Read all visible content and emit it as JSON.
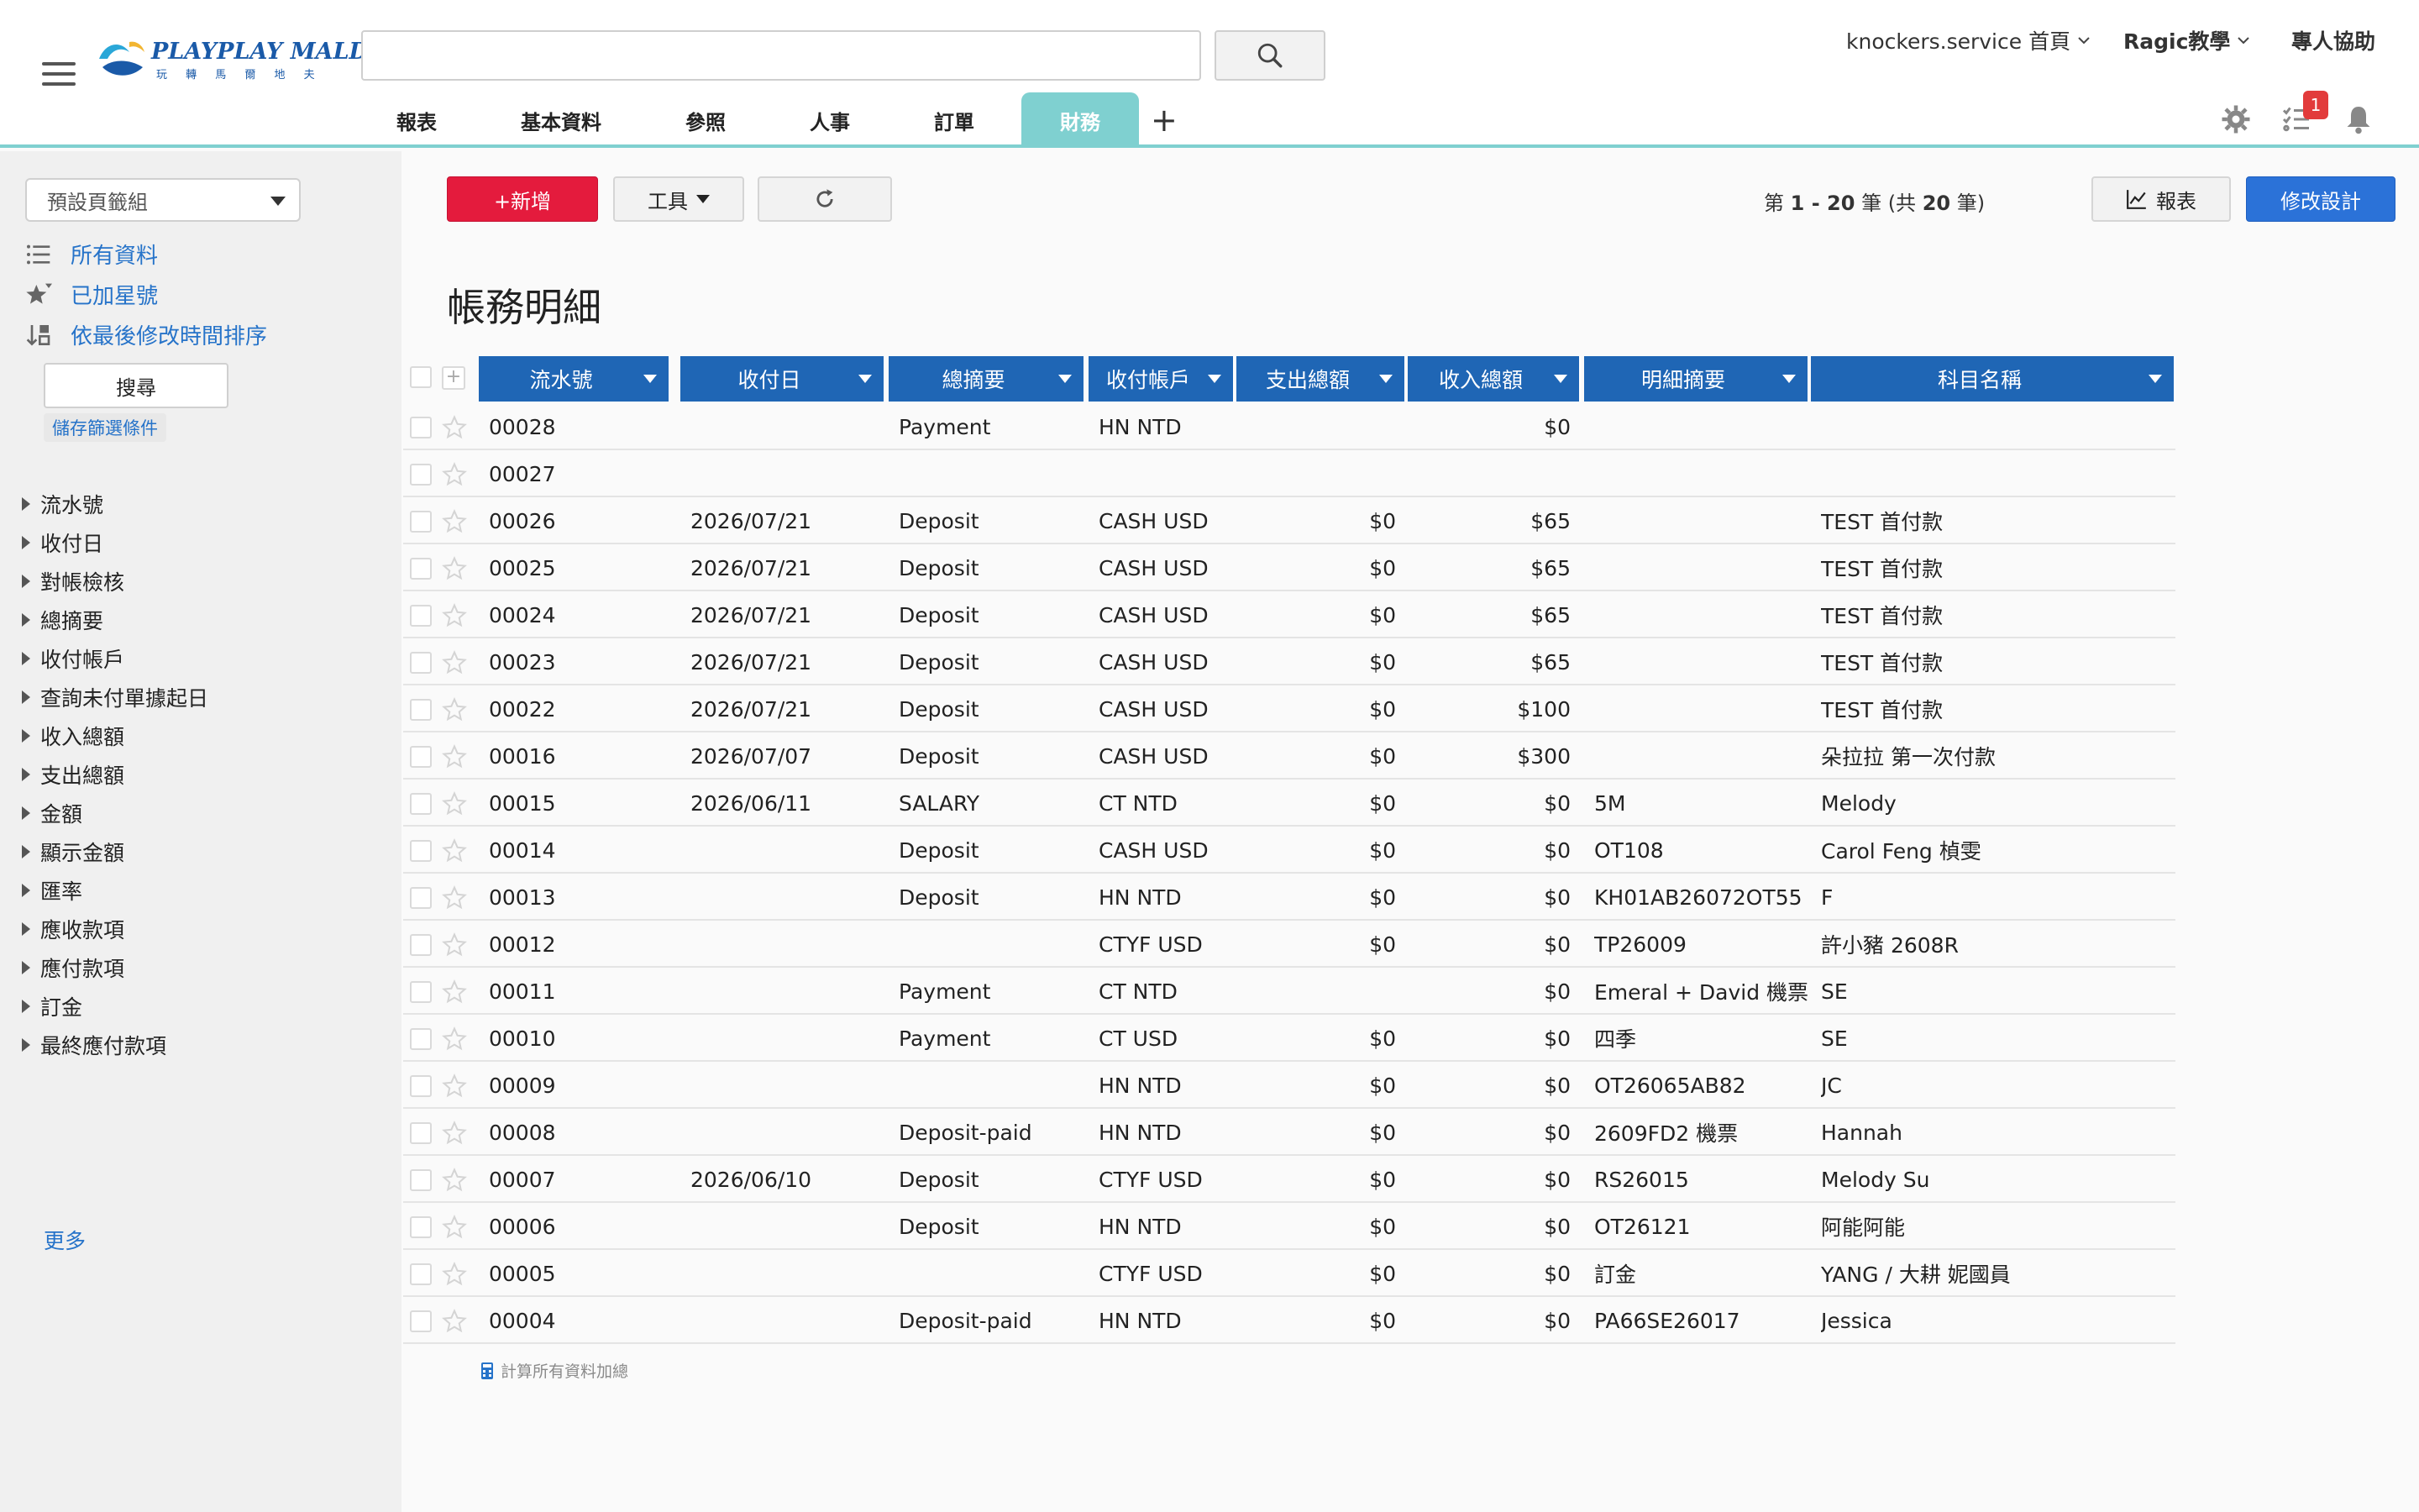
{
  "header": {
    "logo_text": "PLAYPLAY MALDIVES",
    "logo_sub": "玩 轉 馬 爾 地 夫",
    "search_placeholder": "",
    "user_menu": "knockers.service 首頁",
    "tutorial_menu": "Ragic教學",
    "help_link": "專人協助",
    "notification_count": "1"
  },
  "tabs": [
    {
      "label": "報表"
    },
    {
      "label": "基本資料"
    },
    {
      "label": "參照"
    },
    {
      "label": "人事"
    },
    {
      "label": "訂單"
    },
    {
      "label": "財務"
    }
  ],
  "tab_add": "+",
  "sidebar": {
    "tab_group": "預設頁籤組",
    "links": [
      {
        "label": "所有資料",
        "icon": "list-icon"
      },
      {
        "label": "已加星號",
        "icon": "star-filter-icon"
      },
      {
        "label": "依最後修改時間排序",
        "icon": "sort-icon"
      }
    ],
    "search_button": "搜尋",
    "save_filter": "儲存篩選條件",
    "fields": [
      "流水號",
      "收付日",
      "對帳檢核",
      "總摘要",
      "收付帳戶",
      "查詢未付單據起日",
      "收入總額",
      "支出總額",
      "金額",
      "顯示金額",
      "匯率",
      "應收款項",
      "應付款項",
      "訂金",
      "最終應付款項"
    ],
    "more": "更多"
  },
  "toolbar": {
    "add_label": "+新增",
    "tools_label": "工具",
    "report_label": "報表",
    "design_label": "修改設計",
    "count_prefix": "第",
    "count_range": "1 - 20",
    "count_mid": "筆 (共",
    "count_total": "20",
    "count_suffix": "筆)"
  },
  "page_title": "帳務明細",
  "table": {
    "columns": [
      "流水號",
      "收付日",
      "總摘要",
      "收付帳戶",
      "支出總額",
      "收入總額",
      "明細摘要",
      "科目名稱"
    ],
    "rows": [
      [
        "00028",
        "",
        "Payment",
        "HN NTD",
        "",
        "$0",
        "",
        ""
      ],
      [
        "00027",
        "",
        "",
        "",
        "",
        "",
        "",
        ""
      ],
      [
        "00026",
        "2026/07/21",
        "Deposit",
        "CASH USD",
        "$0",
        "$65",
        "",
        "TEST 首付款"
      ],
      [
        "00025",
        "2026/07/21",
        "Deposit",
        "CASH USD",
        "$0",
        "$65",
        "",
        "TEST 首付款"
      ],
      [
        "00024",
        "2026/07/21",
        "Deposit",
        "CASH USD",
        "$0",
        "$65",
        "",
        "TEST 首付款"
      ],
      [
        "00023",
        "2026/07/21",
        "Deposit",
        "CASH USD",
        "$0",
        "$65",
        "",
        "TEST 首付款"
      ],
      [
        "00022",
        "2026/07/21",
        "Deposit",
        "CASH USD",
        "$0",
        "$100",
        "",
        "TEST 首付款"
      ],
      [
        "00016",
        "2026/07/07",
        "Deposit",
        "CASH USD",
        "$0",
        "$300",
        "",
        "朵拉拉 第一次付款"
      ],
      [
        "00015",
        "2026/06/11",
        "SALARY",
        "CT NTD",
        "$0",
        "$0",
        "5M",
        "Melody"
      ],
      [
        "00014",
        "",
        "Deposit",
        "CASH USD",
        "$0",
        "$0",
        "OT108",
        "Carol Feng 楨雯"
      ],
      [
        "00013",
        "",
        "Deposit",
        "HN NTD",
        "$0",
        "$0",
        "KH01AB26072OT55",
        "F"
      ],
      [
        "00012",
        "",
        "",
        "CTYF USD",
        "$0",
        "$0",
        "TP26009",
        "許小豬 2608R"
      ],
      [
        "00011",
        "",
        "Payment",
        "CT NTD",
        "",
        "$0",
        "Emeral + David 機票",
        "SE"
      ],
      [
        "00010",
        "",
        "Payment",
        "CT USD",
        "$0",
        "$0",
        "四季",
        "SE"
      ],
      [
        "00009",
        "",
        "",
        "HN NTD",
        "$0",
        "$0",
        "OT26065AB82",
        "JC"
      ],
      [
        "00008",
        "",
        "Deposit-paid",
        "HN NTD",
        "$0",
        "$0",
        "2609FD2 機票",
        "Hannah"
      ],
      [
        "00007",
        "2026/06/10",
        "Deposit",
        "CTYF USD",
        "$0",
        "$0",
        "RS26015",
        "Melody Su"
      ],
      [
        "00006",
        "",
        "Deposit",
        "HN NTD",
        "$0",
        "$0",
        "OT26121",
        "阿能阿能"
      ],
      [
        "00005",
        "",
        "",
        "CTYF USD",
        "$0",
        "$0",
        "訂金",
        "YANG / 大耕 妮國員"
      ],
      [
        "00004",
        "",
        "Deposit-paid",
        "HN NTD",
        "$0",
        "$0",
        "PA66SE26017",
        "Jessica"
      ]
    ]
  },
  "footer_sum": "計算所有資料加總",
  "colors": {
    "accent_teal": "#7fd0d0",
    "header_blue": "#1f66b5",
    "add_red": "#e41b3d",
    "design_blue": "#2b72d8",
    "link_blue": "#2673c9"
  }
}
